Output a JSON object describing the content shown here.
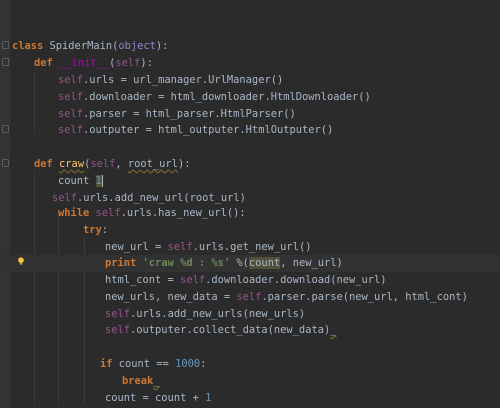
{
  "editor": {
    "language": "Python",
    "colors": {
      "background": "#2b2b2b",
      "keyword": "#cc7832",
      "function_name": "#ffc66d",
      "self": "#94558d",
      "number": "#6897bb",
      "string": "#6a8759",
      "magic_method": "#b200b2",
      "builtin": "#8888c6"
    },
    "lines": [
      {
        "t": [
          [
            "class",
            "kw"
          ],
          [
            " SpiderMain(",
            ""
          ],
          [
            "object",
            "builtin"
          ],
          [
            "):",
            ""
          ]
        ]
      },
      {
        "t": [
          [
            "def",
            "kw"
          ],
          [
            " ",
            ""
          ],
          [
            "__init__",
            "magic"
          ],
          [
            "(",
            ""
          ],
          [
            "self",
            "self"
          ],
          [
            "):",
            ""
          ]
        ]
      },
      {
        "t": [
          [
            "self",
            "self"
          ],
          [
            ".urls = url_manager.UrlManager()",
            ""
          ]
        ]
      },
      {
        "t": [
          [
            "self",
            "self"
          ],
          [
            ".downloader = html_downloader.HtmlDownloader()",
            ""
          ]
        ]
      },
      {
        "t": [
          [
            "self",
            "self"
          ],
          [
            ".parser = html_parser.HtmlParser()",
            ""
          ]
        ]
      },
      {
        "t": [
          [
            "self",
            "self"
          ],
          [
            ".outputer = html_outputer.HtmlOutputer()",
            ""
          ]
        ]
      },
      {
        "t": [
          [
            "def",
            "kw"
          ],
          [
            " ",
            ""
          ],
          [
            "craw",
            "fn warn"
          ],
          [
            "(",
            ""
          ],
          [
            "self",
            "self"
          ],
          [
            ", ",
            ""
          ],
          [
            "root_url",
            "param warn"
          ],
          [
            "):",
            ""
          ]
        ]
      },
      {
        "t": [
          [
            "count ",
            ""
          ],
          [
            "1",
            "num hl"
          ],
          [
            "",
            "cursor"
          ]
        ]
      },
      {
        "t": [
          [
            "self",
            "self"
          ],
          [
            ".urls.add_new_url(root_url)",
            ""
          ]
        ]
      },
      {
        "t": [
          [
            "while",
            "kw"
          ],
          [
            " ",
            ""
          ],
          [
            "self",
            "self"
          ],
          [
            ".urls.has_new_url():",
            ""
          ]
        ]
      },
      {
        "t": [
          [
            "try",
            "kw"
          ],
          [
            ":",
            ""
          ]
        ]
      },
      {
        "t": [
          [
            "new_url = ",
            ""
          ],
          [
            "self",
            "self"
          ],
          [
            ".urls.get_new_url()",
            ""
          ]
        ]
      },
      {
        "t": [
          [
            "print",
            "kw"
          ],
          [
            " ",
            ""
          ],
          [
            "'craw %d : %s'",
            "str"
          ],
          [
            " %(",
            ""
          ],
          [
            "count",
            "hl"
          ],
          [
            ", new_url)",
            ""
          ]
        ]
      },
      {
        "t": [
          [
            "html_cont = ",
            ""
          ],
          [
            "self",
            "self"
          ],
          [
            ".downloader.download(new_url)",
            ""
          ]
        ]
      },
      {
        "t": [
          [
            "new_urls, new_data = ",
            ""
          ],
          [
            "self",
            "self"
          ],
          [
            ".parser.parse(new_url, html_cont)",
            ""
          ]
        ]
      },
      {
        "t": [
          [
            "self",
            "self"
          ],
          [
            ".urls.add_new_urls(new_urls)",
            ""
          ]
        ]
      },
      {
        "t": [
          [
            "self",
            "self"
          ],
          [
            ".outputer.collect_data(new_data)",
            ""
          ],
          [
            "_",
            "warn"
          ]
        ]
      },
      {
        "t": [
          [
            "if",
            "kw"
          ],
          [
            " count == ",
            ""
          ],
          [
            "1000",
            "num"
          ],
          [
            ":",
            ""
          ]
        ]
      },
      {
        "t": [
          [
            "break",
            "kw"
          ],
          [
            "_",
            "warn"
          ]
        ]
      },
      {
        "t": [
          [
            "count = count + ",
            ""
          ],
          [
            "1",
            "num"
          ]
        ]
      }
    ]
  }
}
